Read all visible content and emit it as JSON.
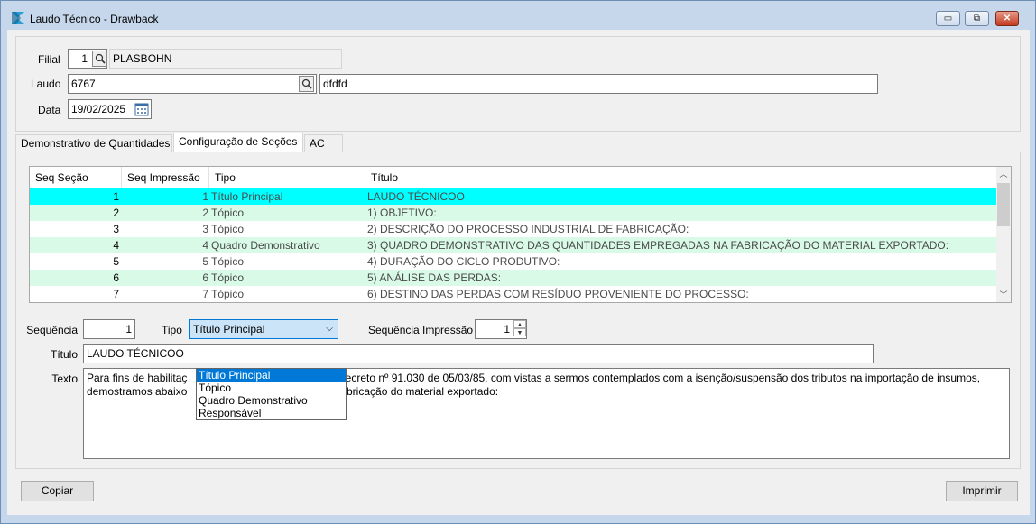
{
  "window": {
    "title": "Laudo Técnico - Drawback",
    "app_icon": "app-logo-icon",
    "minimize_icon": "minimize-icon",
    "maximize_icon": "restore-icon",
    "close_icon": "close-icon"
  },
  "header": {
    "filial_label": "Filial",
    "filial_value": "1",
    "filial_name": "PLASBOHN",
    "laudo_label": "Laudo",
    "laudo_value": "6767",
    "laudo_desc": "dfdfd",
    "data_label": "Data",
    "data_value": "19/02/2025"
  },
  "tabs": [
    {
      "label": "Demonstrativo de Quantidades"
    },
    {
      "label": "Configuração de Seções"
    },
    {
      "label": "AC"
    }
  ],
  "grid": {
    "columns": [
      "Seq Seção",
      "Seq Impressão",
      "Tipo",
      "Título"
    ],
    "rows": [
      {
        "seq": "1",
        "imp": "1",
        "tipo": "Título Principal",
        "titulo": "LAUDO TÉCNICOO"
      },
      {
        "seq": "2",
        "imp": "2",
        "tipo": "Tópico",
        "titulo": "1) OBJETIVO:"
      },
      {
        "seq": "3",
        "imp": "3",
        "tipo": "Tópico",
        "titulo": "2) DESCRIÇÃO DO PROCESSO INDUSTRIAL DE FABRICAÇÃO:"
      },
      {
        "seq": "4",
        "imp": "4",
        "tipo": "Quadro Demonstrativo",
        "titulo": "3) QUADRO DEMONSTRATIVO DAS QUANTIDADES EMPREGADAS NA FABRICAÇÃO DO MATERIAL EXPORTADO:"
      },
      {
        "seq": "5",
        "imp": "5",
        "tipo": "Tópico",
        "titulo": "4) DURAÇÃO DO CICLO PRODUTIVO:"
      },
      {
        "seq": "6",
        "imp": "6",
        "tipo": "Tópico",
        "titulo": "5) ANÁLISE DAS PERDAS:"
      },
      {
        "seq": "7",
        "imp": "7",
        "tipo": "Tópico",
        "titulo": "6) DESTINO DAS PERDAS COM RESÍDUO PROVENIENTE DO PROCESSO:"
      }
    ],
    "colors": {
      "selected": "#00ffff",
      "alternate": "#d9fae7",
      "normal": "#ffffff",
      "titulo_text": "#4a4a4a"
    }
  },
  "editor": {
    "sequencia_label": "Sequência",
    "sequencia_value": "1",
    "tipo_label": "Tipo",
    "tipo_value": "Título Principal",
    "tipo_options": [
      "Título Principal",
      "Tópico",
      "Quadro Demonstrativo",
      "Responsável"
    ],
    "seq_impressao_label": "Sequência Impressão",
    "seq_impressao_value": "1",
    "titulo_label": "Título",
    "titulo_value": "LAUDO TÉCNICOO",
    "texto_label": "Texto",
    "texto_line1_a": "Para fins de habilitaç",
    "texto_line1_b": "Decreto nº 91.030 de 05/03/85, com vistas a sermos contemplados com a isenção/suspensão dos tributos na importação de insumos,",
    "texto_line2_a": "demostramos abaixo",
    "texto_line2_b": "fabricação do material exportado:"
  },
  "buttons": {
    "copiar": "Copiar",
    "imprimir": "Imprimir"
  }
}
